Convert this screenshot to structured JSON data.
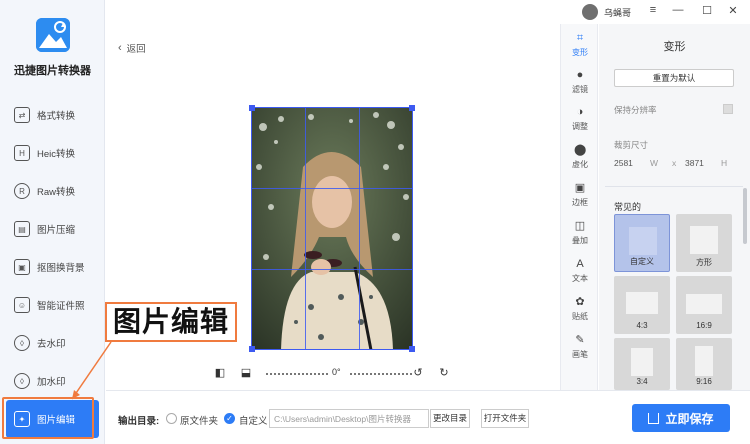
{
  "app": {
    "name": "迅捷图片转换器"
  },
  "sidebar": {
    "items": [
      {
        "label": "格式转换",
        "icon": "convert-icon"
      },
      {
        "label": "Heic转换",
        "icon": "heic-icon"
      },
      {
        "label": "Raw转换",
        "icon": "raw-icon"
      },
      {
        "label": "图片压缩",
        "icon": "compress-icon"
      },
      {
        "label": "抠图换背景",
        "icon": "matting-icon"
      },
      {
        "label": "智能证件照",
        "icon": "id-photo-icon"
      },
      {
        "label": "去水印",
        "icon": "remove-watermark-icon"
      },
      {
        "label": "加水印",
        "icon": "add-watermark-icon"
      },
      {
        "label": "图片编辑",
        "icon": "image-edit-icon"
      }
    ],
    "active_index": 8
  },
  "annotation": {
    "label": "图片编辑"
  },
  "main": {
    "back_label": "返回",
    "rotation_angle": "0°"
  },
  "topbar": {
    "username": "乌蝇哥",
    "menu_icon": "hamburger-icon",
    "min_icon": "minimize-icon",
    "max_icon": "maximize-icon",
    "close_icon": "close-icon"
  },
  "tools": [
    {
      "label": "变形",
      "icon": "crop-icon",
      "active": true
    },
    {
      "label": "滤镜",
      "icon": "filter-icon"
    },
    {
      "label": "调整",
      "icon": "adjust-icon"
    },
    {
      "label": "虚化",
      "icon": "blur-icon"
    },
    {
      "label": "边框",
      "icon": "border-icon"
    },
    {
      "label": "叠加",
      "icon": "overlay-icon"
    },
    {
      "label": "文本",
      "icon": "text-icon"
    },
    {
      "label": "贴纸",
      "icon": "sticker-icon"
    },
    {
      "label": "画笔",
      "icon": "brush-icon"
    }
  ],
  "panel": {
    "title": "变形",
    "reset_label": "重置为默认",
    "keep_resolution_label": "保持分辨率",
    "crop_size_label": "裁剪尺寸",
    "width_value": "2581",
    "width_unit": "W",
    "times": "x",
    "height_value": "3871",
    "height_unit": "H",
    "common_label": "常见的",
    "ratios": [
      {
        "label": "自定义"
      },
      {
        "label": "方形"
      },
      {
        "label": "4:3"
      },
      {
        "label": "16:9"
      },
      {
        "label": "3:4"
      },
      {
        "label": "9:16"
      }
    ]
  },
  "bottom": {
    "output_label": "输出目录:",
    "option_original": "原文件夹",
    "option_custom": "自定义",
    "path_value": "C:\\Users\\admin\\Desktop\\图片转换器",
    "change_dir_label": "更改目录",
    "open_folder_label": "打开文件夹",
    "save_label": "立即保存"
  },
  "colors": {
    "accent": "#2d7cf6",
    "highlight": "#f07b3f",
    "crop_line": "#3d5af1"
  }
}
